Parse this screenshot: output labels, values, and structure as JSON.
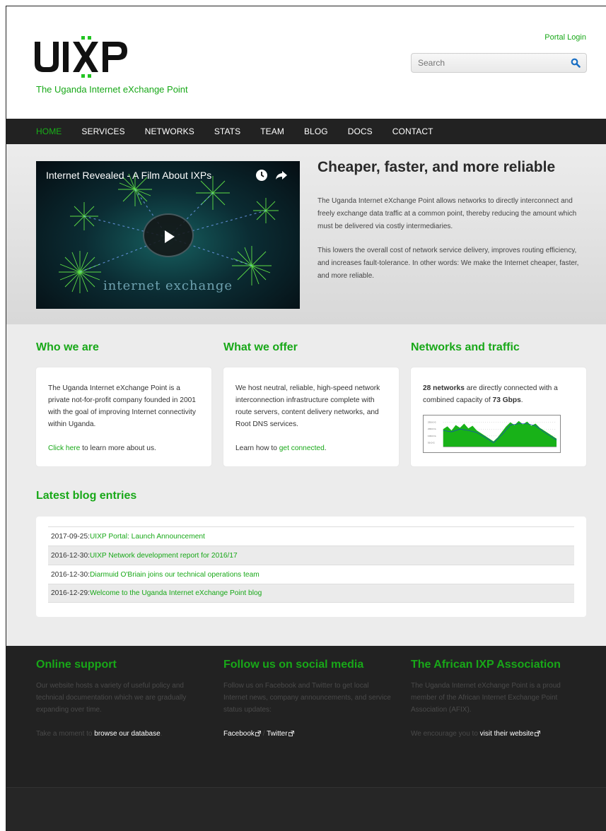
{
  "header": {
    "logo_text": "UIXP",
    "tagline": "The Uganda Internet eXchange Point",
    "portal_login": "Portal Login",
    "search_placeholder": "Search"
  },
  "nav": [
    "HOME",
    "SERVICES",
    "NETWORKS",
    "STATS",
    "TEAM",
    "BLOG",
    "DOCS",
    "CONTACT"
  ],
  "hero": {
    "video_title": "Internet Revealed - A Film About IXPs",
    "video_caption": "internet exchange",
    "title": "Cheaper, faster, and more reliable",
    "p1": "The Uganda Internet eXchange Point allows networks to directly interconnect and freely exchange data traffic at a common point, thereby reducing the amount which must be delivered via costly intermediaries.",
    "p2": "This lowers the overall cost of network service delivery, improves routing efficiency, and increases fault-tolerance. In other words: We make the Internet cheaper, faster, and more reliable."
  },
  "columns": {
    "who": {
      "title": "Who we are",
      "text": "The Uganda Internet eXchange Point is a private not-for-profit company founded in 2001 with the goal of improving Internet connectivity within Uganda.",
      "link": "Click here",
      "link_suffix": " to learn more about us."
    },
    "offer": {
      "title": "What we offer",
      "text": "We host neutral, reliable, high-speed network interconnection infrastructure complete with route servers, content delivery networks, and Root DNS services.",
      "prefix": "Learn how to ",
      "link": "get connected",
      "suffix": "."
    },
    "traffic": {
      "title": "Networks and traffic",
      "networks": "28 networks",
      "mid": " are directly connected with a combined capacity of ",
      "capacity": "73 Gbps",
      "end": "."
    }
  },
  "blog": {
    "title": "Latest blog entries",
    "entries": [
      {
        "date": "2017-09-25: ",
        "title": "UIXP Portal: Launch Announcement"
      },
      {
        "date": "2016-12-30: ",
        "title": "UIXP Network development report for 2016/17"
      },
      {
        "date": "2016-12-30: ",
        "title": "Diarmuid O'Briain joins our technical operations team"
      },
      {
        "date": "2016-12-29: ",
        "title": "Welcome to the Uganda Internet eXchange Point blog"
      }
    ]
  },
  "footer": {
    "support": {
      "title": "Online support",
      "text": "Our website hosts a variety of useful policy and technical documentation which we are gradually expanding over time.",
      "prefix": "Take a moment to ",
      "link": "browse our database",
      "suffix": "."
    },
    "social": {
      "title": "Follow us on social media",
      "text": "Follow us on Facebook and Twitter to get local Internet news, company announcements, and service status updates:",
      "facebook": "Facebook",
      "sep": " / ",
      "twitter": "Twitter"
    },
    "afix": {
      "title": "The African IXP Association",
      "text": "The Uganda Internet eXchange Point is a proud member of the African Internet Exchange Point Association (AFIX).",
      "prefix": "We encourage you to ",
      "link": "visit their website"
    }
  },
  "colors": {
    "accent": "#18a818",
    "dark": "#222222"
  }
}
